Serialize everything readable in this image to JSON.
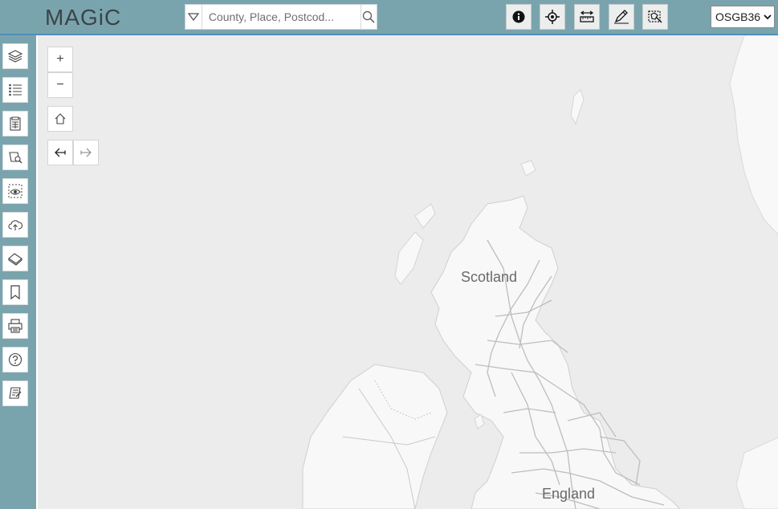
{
  "app": {
    "logo_text": "MAGiC"
  },
  "search": {
    "placeholder": "County, Place, Postcod...",
    "dropdown_icon": "triangle-down-icon",
    "search_icon": "search-icon"
  },
  "toolbar": {
    "buttons": [
      {
        "name": "info",
        "icon": "info-icon"
      },
      {
        "name": "locate",
        "icon": "crosshair-icon"
      },
      {
        "name": "measure",
        "icon": "ruler-icon"
      },
      {
        "name": "draw",
        "icon": "pencil-icon"
      },
      {
        "name": "select",
        "icon": "select-map-icon"
      }
    ]
  },
  "crs_select": {
    "value": "OSGB36",
    "options": [
      "OSGB36"
    ]
  },
  "sidebar": {
    "items": [
      {
        "name": "layers",
        "icon": "layers-icon"
      },
      {
        "name": "legend",
        "icon": "list-icon"
      },
      {
        "name": "map-info",
        "icon": "table-icon"
      },
      {
        "name": "search-map",
        "icon": "map-search-icon"
      },
      {
        "name": "view",
        "icon": "eye-icon"
      },
      {
        "name": "upload",
        "icon": "cloud-upload-icon"
      },
      {
        "name": "basemaps",
        "icon": "eraser-icon"
      },
      {
        "name": "bookmarks",
        "icon": "bookmark-icon"
      },
      {
        "name": "print",
        "icon": "printer-icon"
      },
      {
        "name": "help",
        "icon": "help-icon"
      },
      {
        "name": "notes",
        "icon": "notes-icon"
      }
    ]
  },
  "map_controls": {
    "zoom_in": "+",
    "zoom_out": "−",
    "home_icon": "home-icon",
    "back_icon": "arrow-left-icon",
    "forward_icon": "arrow-right-icon"
  },
  "map_labels": {
    "scotland": "Scotland",
    "england": "England"
  },
  "colors": {
    "header_bg": "#7aa4ad",
    "map_bg": "#ececec",
    "land": "#f8f8f8",
    "road": "#bdbdbd"
  }
}
